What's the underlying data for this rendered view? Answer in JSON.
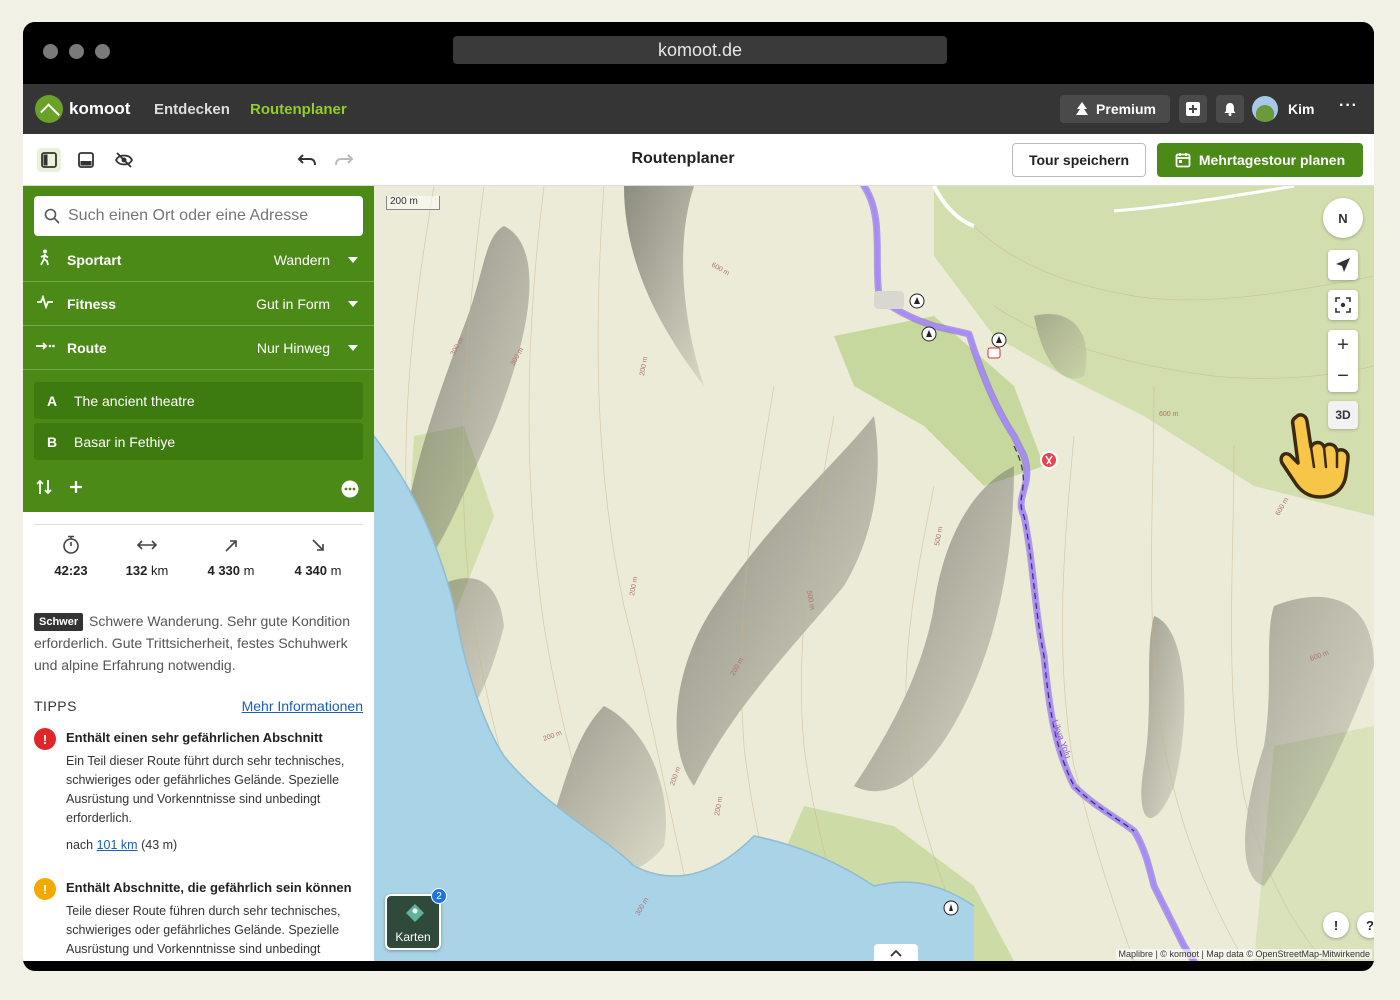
{
  "browser": {
    "url": "komoot.de"
  },
  "nav": {
    "brand": "komoot",
    "links": [
      {
        "label": "Entdecken"
      },
      {
        "label": "Routenplaner"
      }
    ],
    "premium_label": "Premium",
    "user_name": "Kim"
  },
  "toolbar": {
    "title": "Routenplaner",
    "save_label": "Tour speichern",
    "multiday_label": "Mehrtagestour planen"
  },
  "planner": {
    "search_placeholder": "Such einen Ort oder eine Adresse",
    "options": [
      {
        "label": "Sportart",
        "value": "Wandern",
        "icon": "hiker-icon"
      },
      {
        "label": "Fitness",
        "value": "Gut in Form",
        "icon": "pulse-icon"
      },
      {
        "label": "Route",
        "value": "Nur Hinweg",
        "icon": "arrow-right-icon"
      }
    ],
    "waypoints": [
      {
        "letter": "A",
        "name": "The ancient theatre"
      },
      {
        "letter": "B",
        "name": "Basar in Fethiye"
      }
    ]
  },
  "stats": [
    {
      "icon": "stopwatch-icon",
      "value": "42:23",
      "unit": ""
    },
    {
      "icon": "distance-icon",
      "value": "132",
      "unit": "km"
    },
    {
      "icon": "uphill-icon",
      "value": "4 330",
      "unit": "m"
    },
    {
      "icon": "downhill-icon",
      "value": "4 340",
      "unit": "m"
    }
  ],
  "difficulty": {
    "badge": "Schwer",
    "text": "Schwere Wanderung. Sehr gute Kondition erforderlich. Gute Trittsicherheit, festes Schuhwerk und alpine Erfahrung notwendig."
  },
  "tips": {
    "heading": "TIPPS",
    "more_link": "Mehr Informationen",
    "items": [
      {
        "color": "#e0262a",
        "title": "Enthält einen sehr gefährlichen Abschnitt",
        "body": "Ein Teil dieser Route führt durch sehr technisches, schwieriges oder gefährliches Gelände. Spezielle Ausrüstung und Vorkenntnisse sind unbedingt erforderlich.",
        "after_prefix": "nach",
        "after_link": "101 km",
        "after_suffix": "(43 m)"
      },
      {
        "color": "#f2a900",
        "title": "Enthält Abschnitte, die gefährlich sein können",
        "body": "Teile dieser Route führen durch sehr technisches, schwieriges oder gefährliches Gelände. Spezielle Ausrüstung und Vorkenntnisse sind unbedingt erforderlich."
      }
    ]
  },
  "map": {
    "scale_label": "200 m",
    "compass_label": "N",
    "three_d_label": "3D",
    "layers_label": "Karten",
    "layers_count": "2",
    "attribution": "Maplibre | © komoot | Map data © OpenStreetMap-Mitwirkende",
    "route_color": "#a78bfa",
    "contour_labels": [
      "600 m",
      "300 m",
      "300 m",
      "200 m",
      "200 m",
      "200 m",
      "200 m",
      "200 m",
      "200 m",
      "300 m",
      "500 m",
      "600 m",
      "600 m",
      "500 m",
      "600 m"
    ],
    "trail_label": "Likya Yolu"
  }
}
